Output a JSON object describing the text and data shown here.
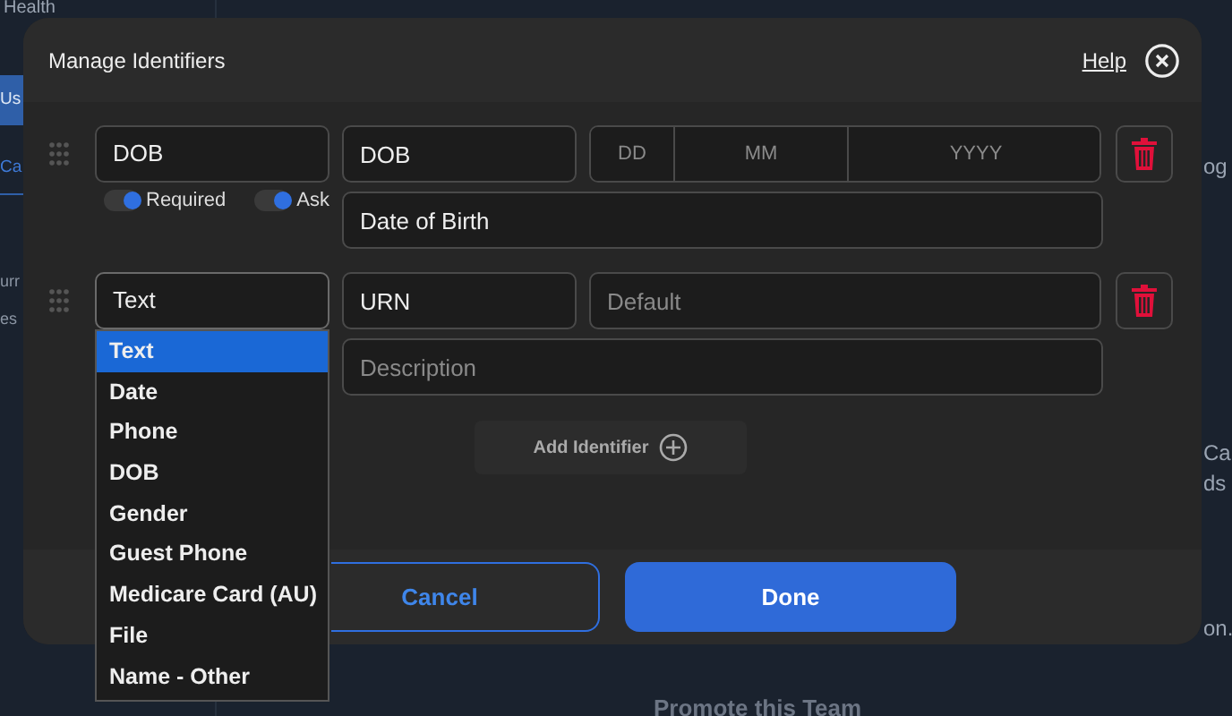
{
  "background_page": {
    "sidebar_title": "Health",
    "sidebar_items": [
      {
        "label": "Us",
        "selected": true
      },
      {
        "label": "Ca",
        "selected": false
      }
    ],
    "sidebar_texts": [
      "urr",
      "es"
    ],
    "right_texts": [
      "og",
      "Ca",
      "ds",
      "on."
    ],
    "section_title": "Promote this Team"
  },
  "dialog": {
    "title": "Manage Identifiers",
    "help": "Help",
    "identifiers": [
      {
        "type": "DOB",
        "name": "DOB",
        "kind": "date",
        "date_placeholders": [
          "DD",
          "MM",
          "YYYY"
        ],
        "description": "Date of Birth",
        "toggles": [
          {
            "label": "Required",
            "on": true
          },
          {
            "label": "Ask",
            "on": true
          }
        ]
      },
      {
        "type": "Text",
        "name": "URN",
        "kind": "text",
        "default_placeholder": "Default",
        "description_placeholder": "Description",
        "dropdown": {
          "open": true,
          "options": [
            {
              "label": "Text",
              "selected": true
            },
            {
              "label": "Date",
              "selected": false
            },
            {
              "label": "Phone",
              "selected": false
            },
            {
              "label": "DOB",
              "selected": false
            },
            {
              "label": "Gender",
              "selected": false
            },
            {
              "label": "Guest Phone",
              "selected": false
            },
            {
              "label": "Medicare Card (AU)",
              "selected": false
            },
            {
              "label": "File",
              "selected": false
            },
            {
              "label": "Name - Other",
              "selected": false
            }
          ]
        }
      }
    ],
    "add_button": "Add Identifier",
    "buttons": [
      {
        "label": "Cancel",
        "kind": "secondary"
      },
      {
        "label": "Done",
        "kind": "primary"
      }
    ]
  }
}
